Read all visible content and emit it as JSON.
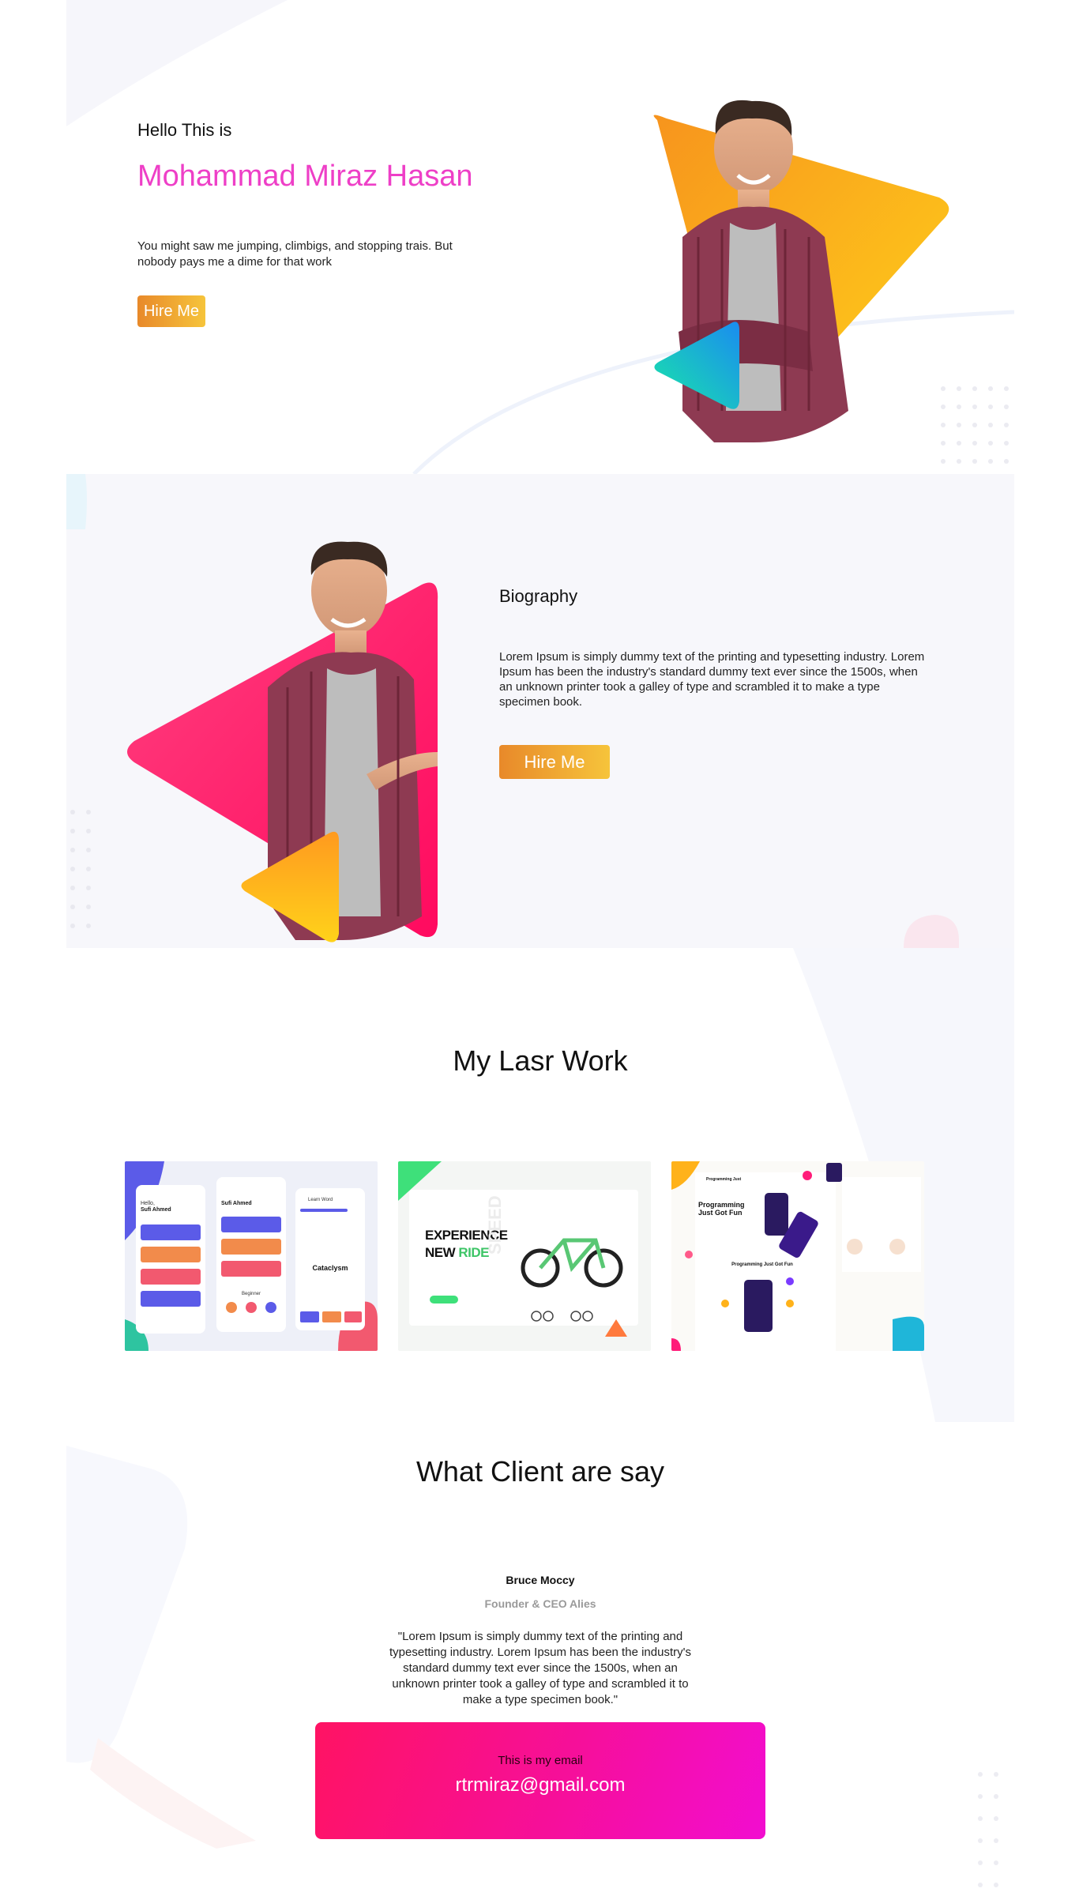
{
  "hero": {
    "greeting": "Hello This is",
    "name": "Mohammad Miraz Hasan",
    "description": "You might saw me jumping, climbigs, and stopping trais. But nobody pays me a dime for that work",
    "button_label": "Hire Me"
  },
  "biography": {
    "title": "Biography",
    "text": "Lorem Ipsum is simply dummy text of the printing and typesetting industry. Lorem Ipsum has been the industry's standard dummy text ever since the 1500s, when an unknown printer took a galley of type and scrambled it to make a type specimen book.",
    "button_label": "Hire Me"
  },
  "work": {
    "title": "My Lasr Work",
    "cards": [
      {
        "greeting": "Hello,",
        "user": "Sufi Ahmed",
        "header": "Learn Word",
        "word": "Cataclysm",
        "level": "Beginner"
      },
      {
        "headline_1": "EXPERIENCE",
        "headline_2a": "NEW ",
        "headline_2b": "RIDE",
        "side_word": "SPEED"
      },
      {
        "brand": "Programming Just",
        "headline": "Programming Just Got Fun",
        "section": "Programming Just Got Fun"
      }
    ]
  },
  "testimonial": {
    "title": "What Client are say",
    "client_name": "Bruce Moccy",
    "client_role": "Founder & CEO Alies",
    "quote": "\"Lorem Ipsum is simply dummy text of the printing and typesetting industry. Lorem Ipsum has been the industry's standard dummy text ever since the 1500s, when an unknown printer took a galley of type and scrambled it to make a type specimen book.\""
  },
  "contact": {
    "label": "This is my email",
    "email": "rtrmiraz@gmail.com"
  },
  "colors": {
    "name_pink": "#ee3fc7",
    "button_orange": "#e8892a",
    "button_yellow": "#f6c43b",
    "email_pink": "#ff1363",
    "email_magenta": "#f20dd0"
  }
}
